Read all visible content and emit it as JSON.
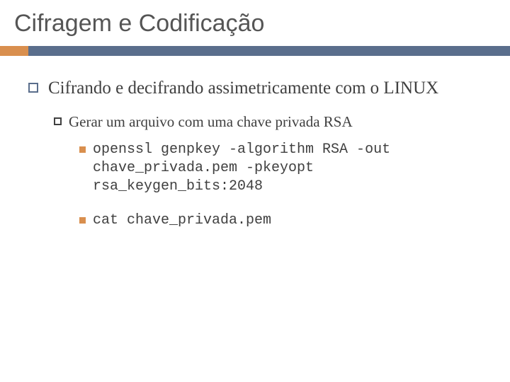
{
  "title": "Cifragem e Codificação",
  "colors": {
    "accent": "#d98f4e",
    "bar": "#5a6e8c",
    "text": "#404040"
  },
  "bullets": {
    "level1": {
      "text": "Cifrando e decifrando assimetricamente com o LINUX"
    },
    "level2": {
      "text": "Gerar um arquivo com uma chave privada RSA"
    },
    "level3": [
      {
        "text": "openssl genpkey -algorithm RSA -out chave_privada.pem -pkeyopt rsa_keygen_bits:2048"
      },
      {
        "text": "cat chave_privada.pem"
      }
    ]
  }
}
